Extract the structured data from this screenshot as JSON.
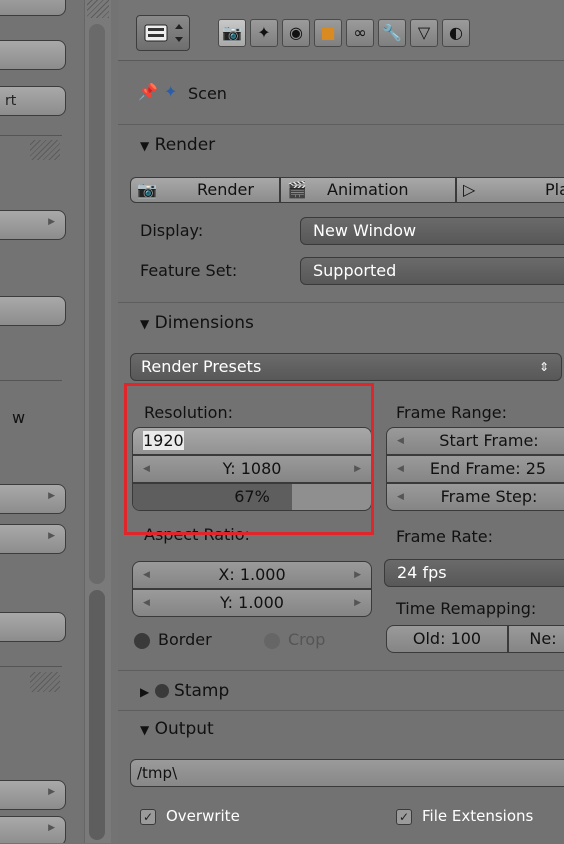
{
  "left_panel": {
    "button_label": "rt",
    "view_label": "w"
  },
  "header": {
    "view_selector_icon": "editor-type-icon",
    "tabs": [
      {
        "icon": "render-camera-icon"
      },
      {
        "icon": "scene-icon"
      },
      {
        "icon": "world-icon"
      },
      {
        "icon": "object-icon"
      },
      {
        "icon": "constraints-icon"
      },
      {
        "icon": "modifiers-icon"
      },
      {
        "icon": "data-icon"
      },
      {
        "icon": "material-icon"
      }
    ]
  },
  "breadcrumb": {
    "scene_label": "Scen"
  },
  "render": {
    "title": "Render",
    "render_button": "Render",
    "animation_button": "Animation",
    "play_button": "Pla",
    "display_label": "Display:",
    "display_value": "New Window",
    "feature_label": "Feature Set:",
    "feature_value": "Supported"
  },
  "dimensions": {
    "title": "Dimensions",
    "presets_label": "Render Presets",
    "resolution_label": "Resolution:",
    "res_x": "1920",
    "res_y": "Y: 1080",
    "res_percent": "67%",
    "res_percent_fill": 0.67,
    "aspect_label": "Aspect Ratio:",
    "aspect_x": "X: 1.000",
    "aspect_y": "Y: 1.000",
    "border_label": "Border",
    "crop_label": "Crop",
    "frame_range_label": "Frame Range:",
    "start_frame": "Start Frame:",
    "end_frame": "End Frame: 25",
    "frame_step": "Frame Step:",
    "frame_rate_label": "Frame Rate:",
    "fps_value": "24 fps",
    "time_remap_label": "Time Remapping:",
    "old_value": "Old: 100",
    "new_value": "Ne:"
  },
  "stamp": {
    "title": "Stamp"
  },
  "output": {
    "title": "Output",
    "path": "/tmp\\",
    "overwrite_label": "Overwrite",
    "file_ext_label": "File Extensions"
  },
  "colors": {
    "highlight_box": "#e0262a",
    "panel_bg": "#727272",
    "field_dark": "#5e5e5e"
  }
}
